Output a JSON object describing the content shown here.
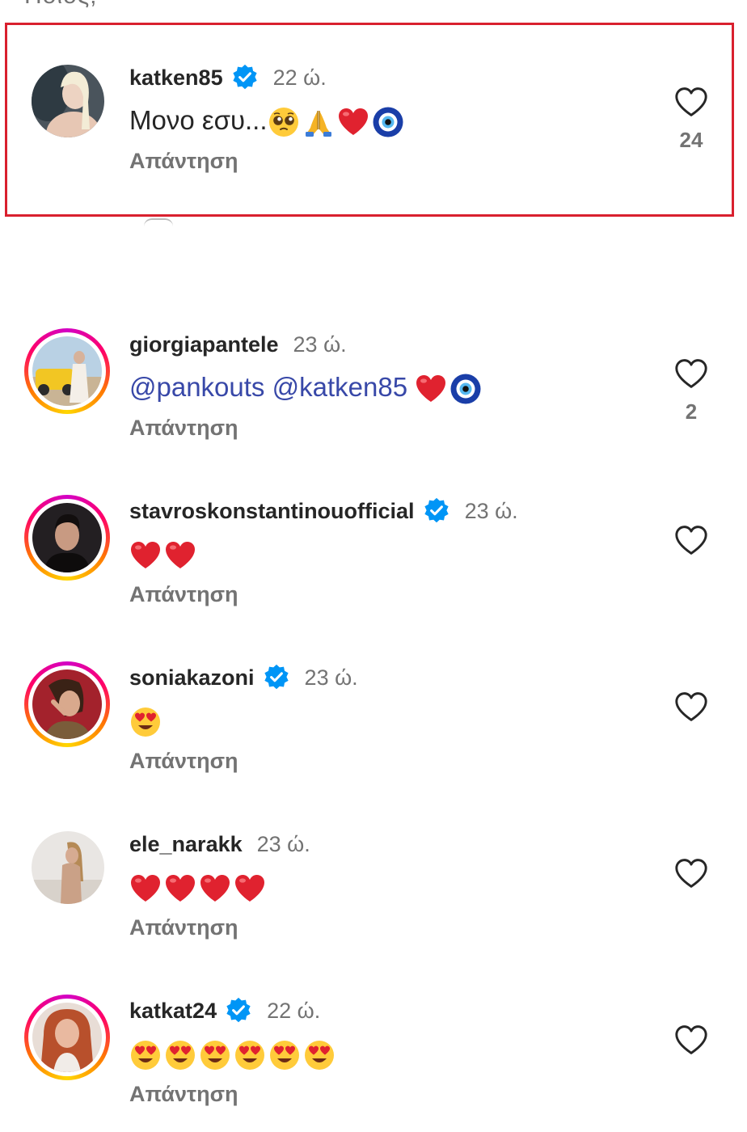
{
  "header_fragment": "Ποιος;",
  "reply_label": "Απάντηση",
  "accent_colors": {
    "highlight": "#d9202e",
    "verified": "#0095f6",
    "mention": "#3848a8",
    "heart_emoji": "#e0222f"
  },
  "comments": [
    {
      "username": "katken85",
      "verified": true,
      "time": "22 ώ.",
      "text": "Μονο εσυ...",
      "emojis": [
        "pleading-face",
        "folded-hands",
        "red-heart",
        "nazar-amulet"
      ],
      "likes": "24",
      "has_story_ring": false,
      "highlighted": true
    },
    {
      "username": "giorgiapantele",
      "verified": false,
      "time": "23 ώ.",
      "mentions": [
        "@pankouts",
        "@katken85"
      ],
      "emojis": [
        "red-heart",
        "nazar-amulet"
      ],
      "likes": "2",
      "has_story_ring": true
    },
    {
      "username": "stavroskonstantinouofficial",
      "verified": true,
      "time": "23 ώ.",
      "emojis": [
        "red-heart",
        "red-heart"
      ],
      "likes": "",
      "has_story_ring": true
    },
    {
      "username": "soniakazoni",
      "verified": true,
      "time": "23 ώ.",
      "emojis": [
        "heart-eyes"
      ],
      "likes": "",
      "has_story_ring": true
    },
    {
      "username": "ele_narakk",
      "verified": false,
      "time": "23 ώ.",
      "emojis": [
        "red-heart",
        "red-heart",
        "red-heart",
        "red-heart"
      ],
      "likes": "",
      "has_story_ring": false
    },
    {
      "username": "katkat24",
      "verified": true,
      "time": "22 ώ.",
      "emojis": [
        "heart-eyes",
        "heart-eyes",
        "heart-eyes",
        "heart-eyes",
        "heart-eyes",
        "heart-eyes"
      ],
      "likes": "",
      "has_story_ring": true
    }
  ]
}
